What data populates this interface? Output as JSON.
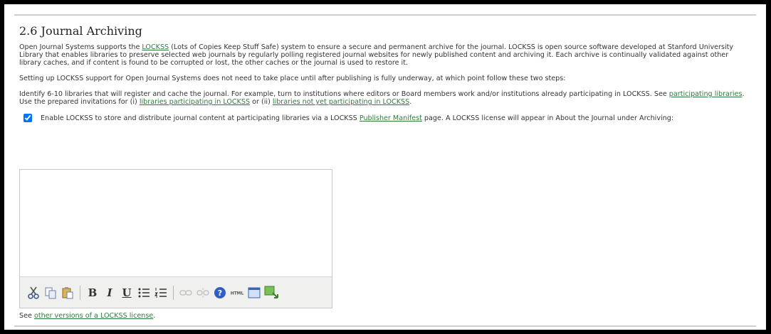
{
  "section": {
    "title": "2.6 Journal Archiving",
    "intro": {
      "before_link": "Open Journal Systems supports the ",
      "link": "LOCKSS",
      "after_link": " (Lots of Copies Keep Stuff Safe) system to ensure a secure and permanent archive for the journal. LOCKSS is open source software developed at Stanford University Library that enables libraries to preserve selected web journals by regularly polling registered journal websites for newly published content and archiving it. Each archive is continually validated against other library caches, and if content is found to be corrupted or lost, the other caches or the journal is used to restore it."
    },
    "setup_text": "Setting up LOCKSS support for Open Journal Systems does not need to take place until after publishing is fully underway, at which point follow these two steps:",
    "identify": {
      "text1": "Identify 6-10 libraries that will register and cache the journal. For example, turn to institutions where editors or Board members work and/or institutions already participating in LOCKSS. See ",
      "link1": "participating libraries",
      "text2": ". Use the prepared invitations for (i) ",
      "link2": "libraries participating in LOCKSS",
      "text3": " or (ii) ",
      "link3": "libraries not yet participating in LOCKSS",
      "text4": "."
    },
    "enable": {
      "checked": true,
      "text1": "Enable LOCKSS to store and distribute journal content at participating libraries via a LOCKSS ",
      "link": "Publisher Manifest",
      "text2": " page. A LOCKSS license will appear in About the Journal under Archiving:"
    },
    "editor": {
      "value": "",
      "toolbar": {
        "cut": "cut-icon",
        "copy": "copy-icon",
        "paste": "paste-icon",
        "bold": "B",
        "italic": "I",
        "underline": "U",
        "bullets": "unordered-list-icon",
        "numbers": "ordered-list-icon",
        "link": "link-icon",
        "unlink": "unlink-icon",
        "help": "help-icon",
        "html": "HTML",
        "fullscreen": "fullscreen-icon",
        "upload": "image-upload-icon"
      }
    },
    "see": {
      "text": "See ",
      "link": "other versions of a LOCKSS license",
      "after": "."
    }
  },
  "colors": {
    "link": "#2f7a3a",
    "text": "#333333",
    "toolbar": "#f0f0ee"
  }
}
